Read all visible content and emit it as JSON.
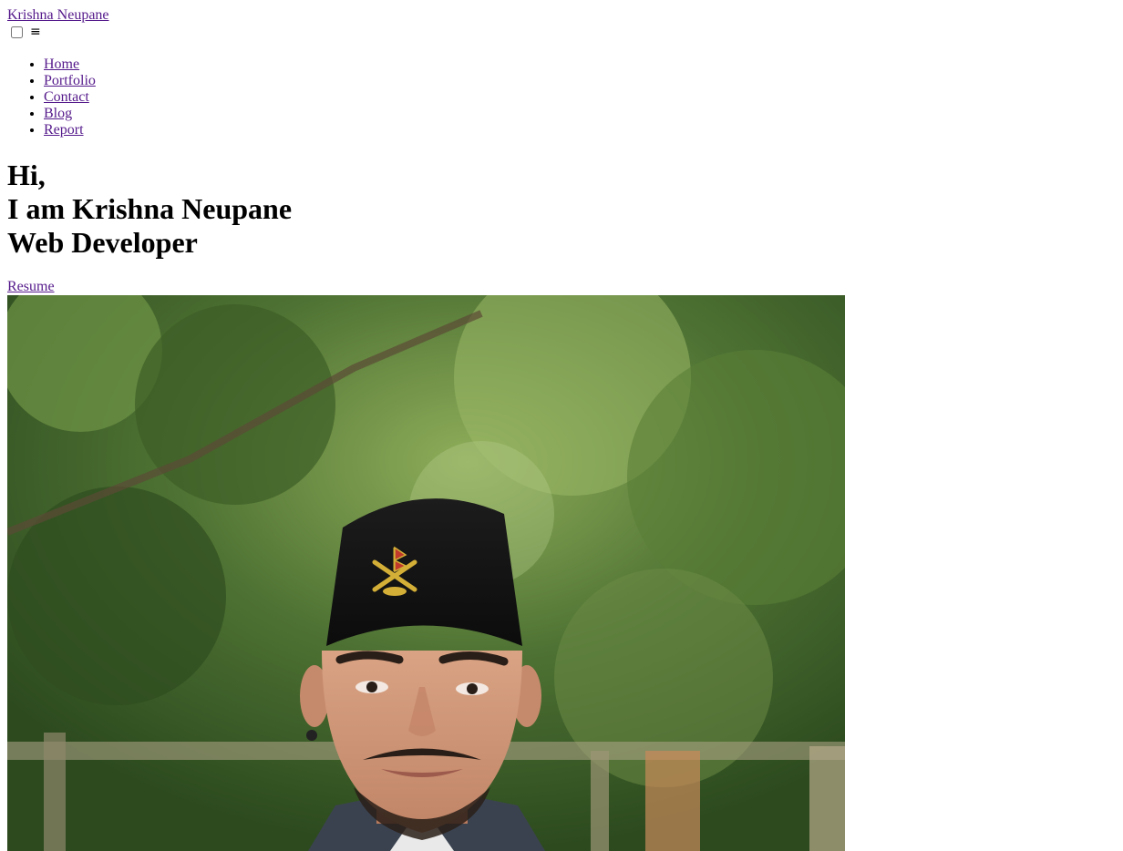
{
  "header": {
    "brand": "Krishna Neupane",
    "menu_icon": "≡"
  },
  "nav": {
    "items": [
      "Home",
      "Portfolio",
      "Contact",
      "Blog",
      "Report"
    ]
  },
  "hero": {
    "line1": "Hi,",
    "line2": "I am Krishna Neupane",
    "line3": "Web Developer"
  },
  "resume": {
    "label": "Resume"
  },
  "colors": {
    "link": "#551a8b",
    "text": "#000000",
    "background": "#ffffff"
  }
}
